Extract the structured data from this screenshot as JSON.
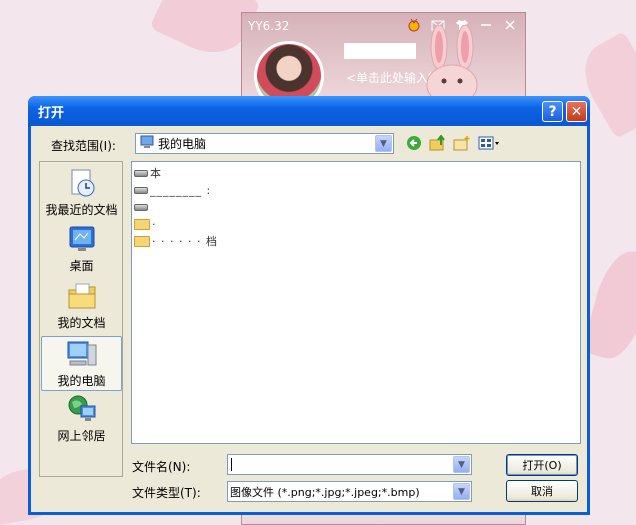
{
  "yy": {
    "title": "YY6.32",
    "signature_prompt": "<单击此处输入签名>",
    "icons": [
      "medal-icon",
      "mail-icon",
      "shirt-icon",
      "minimize-icon",
      "close-icon"
    ]
  },
  "dialog": {
    "title": "打开",
    "help_label": "?",
    "close_label": "✕",
    "look_in_label": "查找范围(I):",
    "look_in_value": "我的电脑",
    "toolbar_icons": [
      "back-icon",
      "up-folder-icon",
      "new-folder-icon",
      "view-menu-icon"
    ],
    "places": [
      {
        "label": "我最近的文档",
        "icon": "recent-documents-icon"
      },
      {
        "label": "桌面",
        "icon": "desktop-icon"
      },
      {
        "label": "我的文档",
        "icon": "my-documents-icon"
      },
      {
        "label": "我的电脑",
        "icon": "my-computer-icon",
        "selected": true
      },
      {
        "label": "网上邻居",
        "icon": "network-places-icon"
      }
    ],
    "files": [
      {
        "type": "drive",
        "name": "本"
      },
      {
        "type": "drive",
        "name": "________  :"
      },
      {
        "type": "drive",
        "name": ""
      },
      {
        "type": "folder",
        "name": "·"
      },
      {
        "type": "folder",
        "name": "·          ·  ·  ·  ·  ·   档"
      }
    ],
    "filename_label": "文件名(N):",
    "filename_value": "",
    "filetype_label": "文件类型(T):",
    "filetype_value": "图像文件 (*.png;*.jpg;*.jpeg;*.bmp)",
    "open_button": "打开(O)",
    "cancel_button": "取消"
  }
}
